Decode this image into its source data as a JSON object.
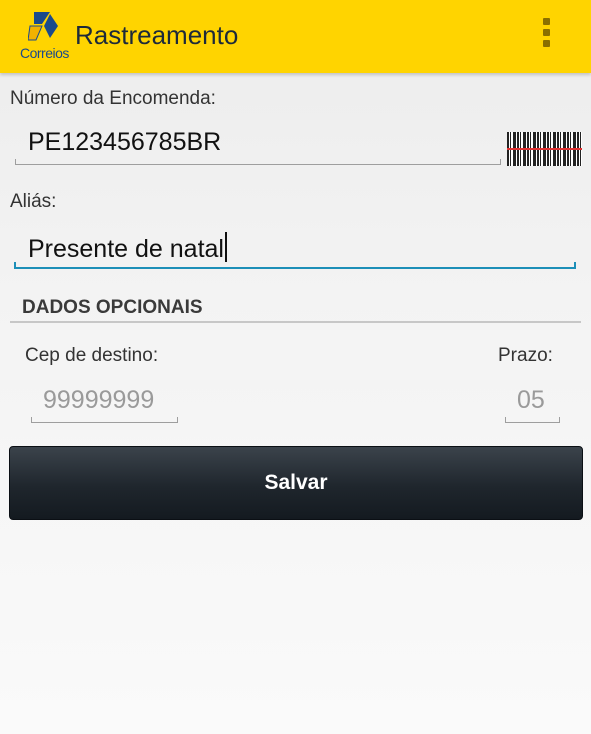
{
  "app": {
    "title": "Rastreamento",
    "logo_text": "Correios",
    "brand_color": "#ffd400"
  },
  "form": {
    "tracking": {
      "label": "Número da Encomenda:",
      "value": "PE123456785BR"
    },
    "alias": {
      "label": "Aliás:",
      "value": "Presente de natal"
    },
    "optional": {
      "section_title": "DADOS OPCIONAIS",
      "cep": {
        "label": "Cep de destino:",
        "placeholder": "99999999"
      },
      "prazo": {
        "label": "Prazo:",
        "placeholder": "05"
      }
    },
    "save_label": "Salvar"
  },
  "colors": {
    "accent_underline": "#1d8fb8",
    "button_dark": "#1f262d"
  },
  "icons": {
    "logo": "correios-logo-icon",
    "menu": "overflow-menu-icon",
    "scan": "barcode-scan-icon"
  }
}
